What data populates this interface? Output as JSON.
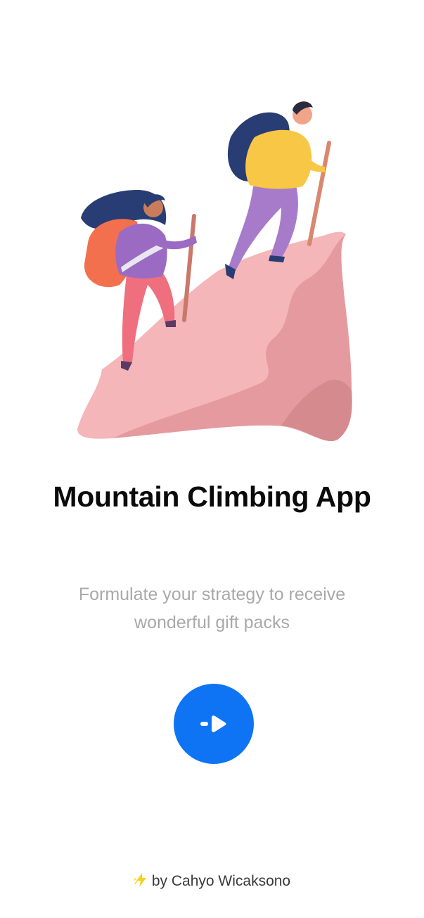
{
  "onboarding": {
    "title": "Mountain Climbing App",
    "subtitle_line1": "Formulate your strategy to receive",
    "subtitle_line2": "wonderful gift packs",
    "start_button_icon": "arrow-right-play-icon",
    "credit_text": "by Cahyo Wicaksono",
    "credit_icon": "lightning-bolt-icon",
    "illustration": "two-hikers-climbing-mountain"
  },
  "colors": {
    "accent": "#0e74f4",
    "title": "#0a0a0a",
    "subtitle": "#a9a9a9",
    "mountain": "#f4b6b8",
    "mountain_shade": "#e49a9e"
  }
}
